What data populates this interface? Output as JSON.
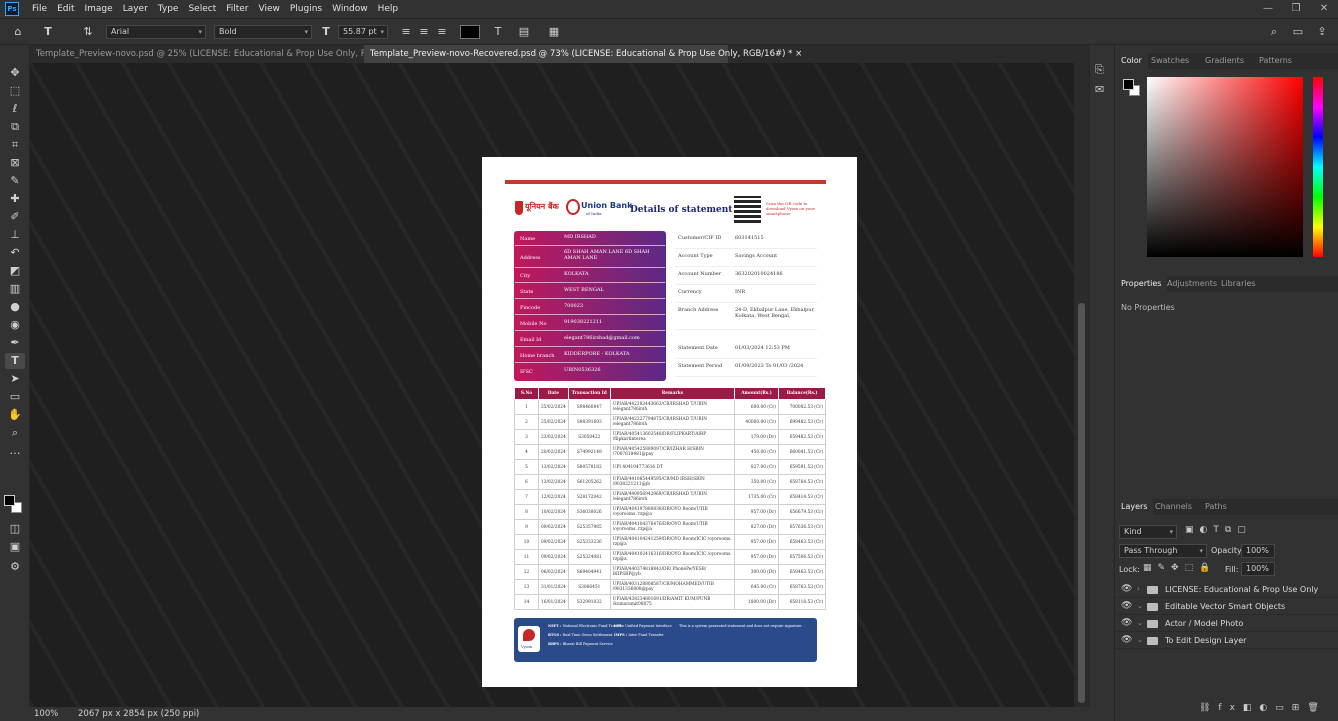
{
  "menu": [
    "File",
    "Edit",
    "Image",
    "Layer",
    "Type",
    "Select",
    "Filter",
    "View",
    "Plugins",
    "Window",
    "Help"
  ],
  "options": {
    "font_family": "Arial",
    "font_style": "Bold",
    "font_size": "55.87 pt",
    "aa_label": "a"
  },
  "tabs": [
    {
      "label": "Template_Preview-novo.psd @ 25% (LICENSE: Educational & Prop Use Only, RGB/16#)",
      "close": "×"
    },
    {
      "label": "Template_Preview-novo-Recovered.psd @ 73% (LICENSE: Educational & Prop Use Only, RGB/16#) *",
      "close": "×"
    }
  ],
  "status": {
    "zoom": "100%",
    "dimensions": "2067 px x 2854 px (250 ppi)"
  },
  "statement": {
    "bank_name": "Union Bank",
    "bank_sub": "of India",
    "bank_hindi": "यूनियन बैंक",
    "title": "Details of statement",
    "qr_note": "Scan the QR code to download Vyom on your smartphone",
    "left_fields": [
      {
        "label": "Name",
        "value": "MD IRSHAD"
      },
      {
        "label": "Address",
        "value": "6D SHAH AMAN LANE 6D SHAH AMAN LANE"
      },
      {
        "label": "City",
        "value": "KOLKATA"
      },
      {
        "label": "State",
        "value": "WEST BENGAL"
      },
      {
        "label": "Pincode",
        "value": "700023"
      },
      {
        "label": "Mobile No",
        "value": "919038221211"
      },
      {
        "label": "Email Id",
        "value": "elegant786irshad@gmail.com"
      },
      {
        "label": "Home branch",
        "value": "KIDDERPORE - KOLKATA"
      },
      {
        "label": "IFSC",
        "value": "UBIN0536326"
      }
    ],
    "right_fields": [
      {
        "label": "Customer/CIF ID",
        "value": "603141515"
      },
      {
        "label": "Account Type",
        "value": "Savings Account"
      },
      {
        "label": "Account Number",
        "value": "363202010024186"
      },
      {
        "label": "Currency",
        "value": "INR"
      },
      {
        "label": "Branch Address",
        "value": "24-D, Ekbalpur Lane, Ekbalpur, Kolkata, West Bengal,"
      }
    ],
    "date_fields": [
      {
        "label": "Statement Date",
        "value": "01/03/2024 12:53 PM"
      },
      {
        "label": "Statement Period",
        "value": "01/09/2023 To 01/03 /2024"
      }
    ],
    "table_headers": [
      "S.No",
      "Date",
      "Transaction Id",
      "Remarks",
      "Amount(Rs.)",
      "Balance(Rs.)"
    ],
    "rows": [
      [
        "1",
        "25/02/2024",
        "S98460847",
        "UPIAB/442283443663/CR/IRSHAD T/UBIN /elegant786irsh",
        "600.00 (Cr)",
        "700082.53 (Cr)"
      ],
      [
        "2",
        "25/02/2024",
        "S98391693",
        "UPIAB/442227794875/CR/IRSHAD T/UBIN /elegant786irsh",
        "40000.00 (Cr)",
        "699482.53 (Cr)"
      ],
      [
        "3",
        "23/02/2024",
        "S3050422",
        "UPIAR/405413603548/DR/FLIPKART/AIRP /flipkartinterea",
        "179.00 (Dr)",
        "659482.53 (Cr)"
      ],
      [
        "4",
        "20/02/2024",
        "S74992149",
        "UPIAR/405425889097/CR/IZHAR H/SBIN /7007819481@pay",
        "450.00 (Cr)",
        "660041.53 (Cr)"
      ],
      [
        "5",
        "13/02/2024",
        "S80578182",
        "UPI 404104773616 DT",
        "827.00 (Cr)",
        "659591.53 (Cr)"
      ],
      [
        "6",
        "13/02/2024",
        "S61205262",
        "UPIAB/441085449595/CR/MD IRSH/SBIN /9038221211@jb",
        "350.00 (Cr)",
        "658764.53 (Cr)"
      ],
      [
        "7",
        "12/02/2024",
        "S28172042",
        "UPIAB/440956942969/CR/IRSHAD T/UBIN /elegant786irsh",
        "1735.00 (Cr)",
        "658414.53 (Cr)"
      ],
      [
        "8",
        "10/02/2024",
        "S36038026",
        "UPIAR/404197880838/DR/OYO Room/UTIB /oyorooms. rzp@a",
        "957.00 (Dr)",
        "656679.53 (Cr)"
      ],
      [
        "9",
        "09/02/2024",
        "S25357985",
        "UPIAR/404104376476/DR/OYO Room/UTIB /oyorooms. rzp@a",
        "827.00 (Dr)",
        "657636.53 (Cr)"
      ],
      [
        "10",
        "09/02/2024",
        "S25333236",
        "UPIAR/404104241259/DR/OYO Room/ICIC /oyorooms. rzp@a",
        "957.00 (Dr)",
        "658463.53 (Cr)"
      ],
      [
        "11",
        "09/02/2024",
        "S25324081",
        "UPIAR/404102416316/DR/OYO Room/ICIC /oyorooms. rzp@a",
        "957.00 (Dr)",
        "657506.53 (Cr)"
      ],
      [
        "12",
        "06/02/2024",
        "S69404941",
        "UPIAR/440374818843/DR/ PhonePe/YESB/ BIIPSBP@yb",
        "300.00 (Dr)",
        "658463.53 (Cr)"
      ],
      [
        "13",
        "31/01/2024",
        "S3066451",
        "UPIAB/403128808587/CR/MOHAMMED/UTIB /9831336808@pay",
        "645.00 (Cr)",
        "658763.53 (Cr)"
      ],
      [
        "14",
        "16/01/2024",
        "S32991032",
        "UPIAR/438234801691/DR/AMIT KUM/PUNB /kumaramit08875",
        "1800.00 (Dr)",
        "658118.53 (Cr)"
      ]
    ],
    "footer": {
      "brand": "Vyom",
      "legend": [
        {
          "key": "NEFT :",
          "value": "National Electronic Fund Transfer"
        },
        {
          "key": "UPI :",
          "value": "Unified Payment Interface"
        },
        {
          "key": "RTGS :",
          "value": "Real Time Gross Settlement"
        },
        {
          "key": "IMPS :",
          "value": "Inter Fund Transfer"
        },
        {
          "key": "BBPS :",
          "value": "Bharat Bill Payment Service"
        }
      ],
      "note": "This is a system generated statement and does not require signature."
    }
  },
  "right_panel": {
    "color_tabs": [
      "Color",
      "Swatches",
      "Gradients",
      "Patterns"
    ],
    "prop_tabs": [
      "Properties",
      "Adjustments",
      "Libraries"
    ],
    "no_properties": "No Properties",
    "layer_tabs": [
      "Layers",
      "Channels",
      "Paths"
    ],
    "kind": "Kind",
    "blend": "Pass Through",
    "opacity_label": "Opacity:",
    "opacity": "100%",
    "lock_label": "Lock:",
    "fill_label": "Fill:",
    "fill": "100%",
    "layers": [
      "LICENSE: Educational & Prop Use Only",
      "Editable Vector Smart Objects",
      "Actor / Model Photo",
      "To Edit Design Layer"
    ]
  },
  "colors": {
    "accent": "#31a8ff",
    "header_red": "#c0392b",
    "table_header": "#9b1b47",
    "panel_grad_start": "#c2185b",
    "panel_grad_end": "#5b2a86",
    "footer_blue": "#2a4a8a"
  }
}
